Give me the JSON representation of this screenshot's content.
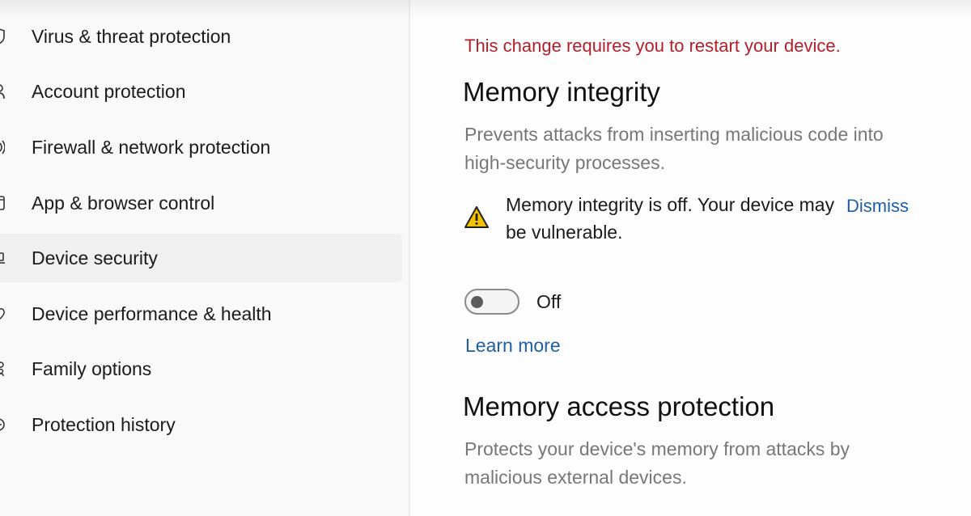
{
  "sidebar": {
    "items": [
      {
        "label": "Virus & threat protection",
        "icon": "shield-icon",
        "active": false
      },
      {
        "label": "Account protection",
        "icon": "person-icon",
        "active": false
      },
      {
        "label": "Firewall & network protection",
        "icon": "wifi-antenna-icon",
        "active": false
      },
      {
        "label": "App & browser control",
        "icon": "app-window-icon",
        "active": false
      },
      {
        "label": "Device security",
        "icon": "laptop-icon",
        "active": true
      },
      {
        "label": "Device performance & health",
        "icon": "heart-icon",
        "active": false
      },
      {
        "label": "Family options",
        "icon": "family-icon",
        "active": false
      },
      {
        "label": "Protection history",
        "icon": "clock-icon",
        "active": false
      }
    ]
  },
  "main": {
    "restart_notice": "This change requires you to restart your device.",
    "memory_integrity": {
      "title": "Memory integrity",
      "description": "Prevents attacks from inserting malicious code into high-security processes.",
      "warning": "Memory integrity is off. Your device may be vulnerable.",
      "dismiss_label": "Dismiss",
      "toggle_state": "Off",
      "learn_more": "Learn more"
    },
    "memory_access": {
      "title": "Memory access protection",
      "description": "Protects your device's memory from attacks by malicious external devices."
    }
  },
  "colors": {
    "warning_red": "#b21f2a",
    "link_blue": "#1f5fa7",
    "warning_yellow": "#f2c200",
    "active_item_bg": "#f0f0f0"
  }
}
